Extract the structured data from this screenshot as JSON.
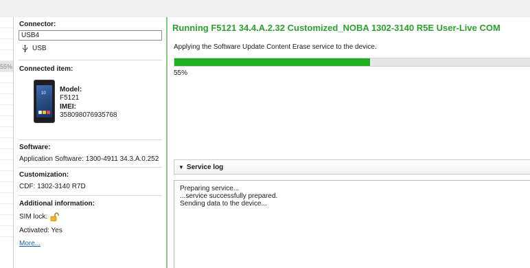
{
  "left_panel": {
    "selected_row_value": "55%"
  },
  "info": {
    "connector_heading": "Connector:",
    "connector_value": "USB4",
    "usb_label": "USB",
    "connected_item_heading": "Connected item:",
    "model_label": "Model:",
    "model_value": "F5121",
    "imei_label": "IMEI:",
    "imei_value": "358098076935768",
    "software_heading": "Software:",
    "software_value": "Application Software: 1300-4911 34.3.A.0.252",
    "customization_heading": "Customization:",
    "customization_value": "CDF: 1302-3140 R7D",
    "additional_heading": "Additional information:",
    "sim_lock": "SIM lock:",
    "activated": "Activated: Yes",
    "more_link": "More..."
  },
  "main": {
    "title": "Running F5121 34.4.A.2.32 Customized_NOBA 1302-3140 R5E User-Live COM",
    "subtitle": "Applying the Software Update Content Erase service to the device.",
    "progress_fraction": 0.55,
    "progress_text": "55%",
    "log_header": "Service log",
    "log_lines": [
      "Preparing service...",
      "...service successfully prepared.",
      "Sending data to the device..."
    ]
  },
  "colors": {
    "accent_green": "#2ca02c",
    "progress_fill": "#1fae1f",
    "link_blue": "#1a5fb4",
    "phone_screen": "#2b4f86"
  },
  "icons": {
    "usb": "usb-icon",
    "lock": "lock-open-icon",
    "collapse": "triangle-down-icon",
    "device": "phone-image"
  }
}
